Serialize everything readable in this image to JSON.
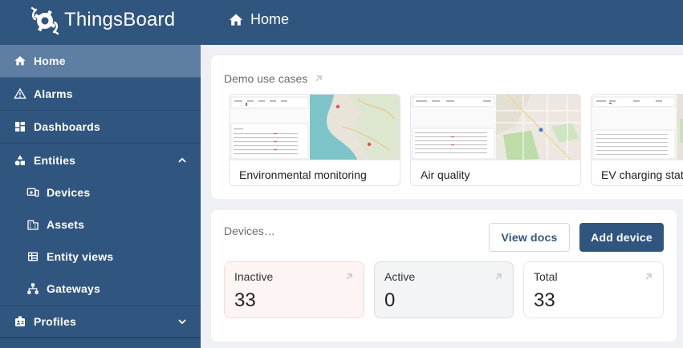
{
  "header": {
    "brand": "ThingsBoard",
    "page_title": "Home"
  },
  "sidebar": {
    "items": [
      {
        "label": "Home",
        "icon": "home-icon",
        "active": true
      },
      {
        "label": "Alarms",
        "icon": "warning-icon"
      },
      {
        "label": "Dashboards",
        "icon": "dashboard-icon"
      },
      {
        "label": "Entities",
        "icon": "entities-icon",
        "expanded": true
      },
      {
        "label": "Devices",
        "icon": "devices-icon"
      },
      {
        "label": "Assets",
        "icon": "assets-icon"
      },
      {
        "label": "Entity views",
        "icon": "entity-views-icon"
      },
      {
        "label": "Gateways",
        "icon": "gateways-icon"
      },
      {
        "label": "Profiles",
        "icon": "profiles-icon",
        "expanded": false
      }
    ]
  },
  "demo": {
    "title": "Demo use cases",
    "cases": [
      {
        "label": "Environmental monitoring"
      },
      {
        "label": "Air quality"
      },
      {
        "label": "EV charging stat"
      }
    ]
  },
  "devices": {
    "title": "Devices…",
    "view_docs_label": "View docs",
    "add_device_label": "Add device",
    "stats": [
      {
        "label": "Inactive",
        "value": "33"
      },
      {
        "label": "Active",
        "value": "0"
      },
      {
        "label": "Total",
        "value": "33"
      }
    ]
  },
  "colors": {
    "primary": "#305680",
    "sidebar_active": "#5e7ea3",
    "background": "#eef0f3"
  }
}
